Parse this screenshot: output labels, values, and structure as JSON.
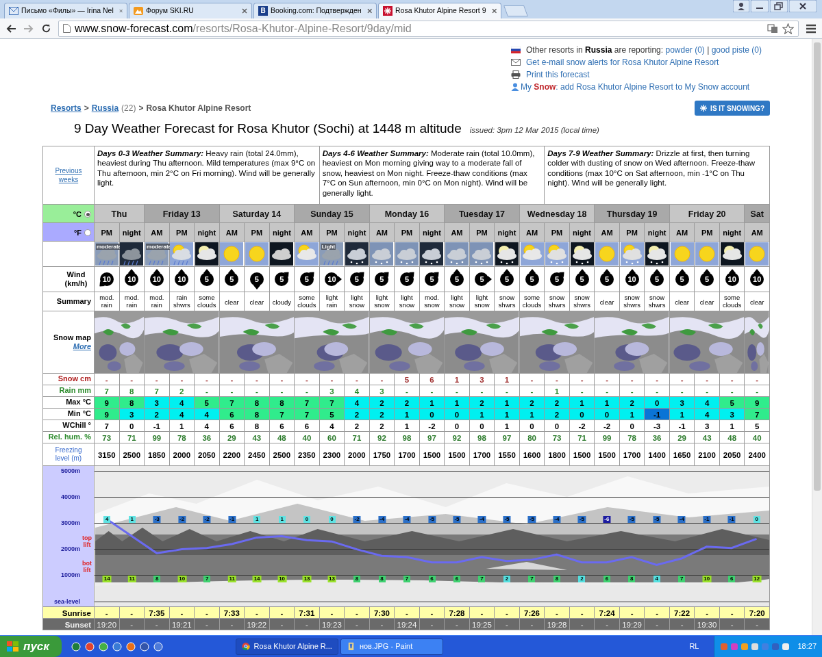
{
  "browser": {
    "tabs": [
      {
        "title": "Письмо «Филы» — Irina Nel",
        "kind": "mail",
        "selected": false
      },
      {
        "title": "Форум SKI.RU",
        "kind": "mountain",
        "selected": false
      },
      {
        "title": "Booking.com: Подтвержден",
        "kind": "letter",
        "favicon_text": "B",
        "selected": false
      },
      {
        "title": "Rosa Khutor Alpine Resort 9",
        "kind": "cross",
        "selected": true
      }
    ],
    "url_host": "www.snow-forecast.com",
    "url_path": "/resorts/Rosa-Khutor-Alpine-Resort/9day/mid"
  },
  "info": {
    "reporting_intro": "Other resorts in **Russia** are reporting:",
    "reporting_links": [
      "powder (0)",
      "good piste (0)"
    ],
    "separator": "|",
    "alerts_link": "Get e-mail snow alerts for Rosa Khutor Alpine Resort",
    "print_link": "Print this forecast",
    "my_snow_link": "My **Snow**: add Rosa Khutor Alpine Resort to My Snow account"
  },
  "breadcrumb": [
    {
      "text": "Resorts",
      "kind": "link"
    },
    {
      "text": ">",
      "kind": "sep"
    },
    {
      "text": "Russia",
      "kind": "link"
    },
    {
      "text": "(22)",
      "kind": "count"
    },
    {
      "text": ">",
      "kind": "sep"
    },
    {
      "text": "Rosa Khutor Alpine Resort",
      "kind": "current"
    }
  ],
  "snowing_button": "IS IT SNOWING?",
  "title": "9 Day Weather Forecast for Rosa Khutor (Sochi) at 1448 m altitude",
  "issued": "issued: 3pm 12 Mar 2015 (local time)",
  "forecast": {
    "previous_link": "Previous weeks",
    "summaries": [
      {
        "title": "Days 0-3 Weather Summary:",
        "text": "Heavy rain (total 24.0mm), heaviest during Thu afternoon. Mild temperatures (max 9°C on Thu afternoon, min 2°C on Fri morning). Wind will be generally light."
      },
      {
        "title": "Days 4-6 Weather Summary:",
        "text": "Moderate rain (total 10.0mm), heaviest on Mon morning giving way to a moderate fall of snow, heaviest on Mon night. Freeze-thaw conditions (max 7°C on Sun afternoon, min 0°C on Mon night). Wind will be generally light."
      },
      {
        "title": "Days 7-9 Weather Summary:",
        "text": "Drizzle at first, then turning colder with dusting of snow on Wed afternoon. Freeze-thaw conditions (max 10°C on Sat afternoon, min -1°C on Thu night). Wind will be generally light."
      }
    ],
    "units": [
      {
        "label": "°C",
        "selected": true
      },
      {
        "label": "°F",
        "selected": false
      }
    ],
    "labels": {
      "wind": "Wind (km/h)",
      "summary": "Summary",
      "snow_map": "Snow map",
      "more": "More",
      "snow": "Snow cm",
      "rain": "Rain mm",
      "max": "Max °C",
      "min": "Min °C",
      "wchill": "WChill °",
      "humidity": "Rel. hum. %",
      "freezing": "Freezing level (m)",
      "top_lift": "top lift",
      "bottom_lift": "bot lift",
      "sunrise": "Sunrise",
      "sunset": "Sunset"
    },
    "days": [
      {
        "label": "Thu",
        "periods": [
          {
            "period": "PM",
            "kind": "cloud-rain",
            "icon_text": "moderate",
            "wind": {
              "speed": "10",
              "kind": "sw"
            },
            "summary": "mod. rain",
            "snow": "-",
            "rain": "7",
            "max": "9",
            "min": "9",
            "wchill": "7",
            "humidity": "73",
            "freezing": "3150",
            "top_lift": "4",
            "bottom_lift": "14",
            "sunrise": "-",
            "sunset": "19:20"
          },
          {
            "period": "night",
            "kind": "night-cloud-rain",
            "wind": {
              "speed": "10",
              "kind": "n"
            },
            "summary": "mod. rain",
            "snow": "-",
            "rain": "8",
            "max": "8",
            "min": "3",
            "wchill": "0",
            "humidity": "71",
            "freezing": "2500",
            "top_lift": "1",
            "bottom_lift": "11",
            "sunrise": "-",
            "sunset": "-"
          }
        ]
      },
      {
        "label": "Friday 13",
        "periods": [
          {
            "period": "AM",
            "kind": "cloud-rain",
            "icon_text": "moderate",
            "wind": {
              "speed": "10",
              "kind": "n"
            },
            "summary": "mod. rain",
            "snow": "-",
            "rain": "7",
            "max": "3",
            "min": "2",
            "wchill": "-1",
            "humidity": "99",
            "freezing": "1850",
            "top_lift": "-3",
            "bottom_lift": "8",
            "sunrise": "7:35",
            "sunset": "-"
          },
          {
            "period": "PM",
            "kind": "sun-cloud-rain",
            "wind": {
              "speed": "10",
              "kind": "n"
            },
            "summary": "rain shwrs",
            "snow": "-",
            "rain": "2",
            "max": "4",
            "min": "4",
            "wchill": "1",
            "humidity": "78",
            "freezing": "2000",
            "top_lift": "-2",
            "bottom_lift": "10",
            "sunrise": "-",
            "sunset": "19:21"
          },
          {
            "period": "night",
            "kind": "moon-cloud",
            "wind": {
              "speed": "5",
              "kind": "n"
            },
            "summary": "some clouds",
            "snow": "-",
            "rain": "-",
            "max": "5",
            "min": "4",
            "wchill": "4",
            "humidity": "36",
            "freezing": "2050",
            "top_lift": "-2",
            "bottom_lift": "7",
            "sunrise": "-",
            "sunset": "-"
          }
        ]
      },
      {
        "label": "Saturday 14",
        "periods": [
          {
            "period": "AM",
            "kind": "sun",
            "wind": {
              "speed": "5",
              "kind": "n"
            },
            "summary": "clear",
            "snow": "-",
            "rain": "-",
            "max": "7",
            "min": "6",
            "wchill": "6",
            "humidity": "29",
            "freezing": "2200",
            "top_lift": "-1",
            "bottom_lift": "11",
            "sunrise": "7:33",
            "sunset": "-"
          },
          {
            "period": "PM",
            "kind": "sun",
            "wind": {
              "speed": "5",
              "kind": "s"
            },
            "summary": "clear",
            "snow": "-",
            "rain": "-",
            "max": "8",
            "min": "8",
            "wchill": "8",
            "humidity": "43",
            "freezing": "2450",
            "top_lift": "1",
            "bottom_lift": "14",
            "sunrise": "-",
            "sunset": "19:22"
          },
          {
            "period": "night",
            "kind": "night-cloud",
            "wind": {
              "speed": "5",
              "kind": "ne"
            },
            "summary": "cloudy",
            "snow": "-",
            "rain": "-",
            "max": "8",
            "min": "7",
            "wchill": "6",
            "humidity": "48",
            "freezing": "2500",
            "top_lift": "1",
            "bottom_lift": "10",
            "sunrise": "-",
            "sunset": "-"
          }
        ]
      },
      {
        "label": "Sunday 15",
        "periods": [
          {
            "period": "AM",
            "kind": "sun-cloud",
            "wind": {
              "speed": "5",
              "kind": "ne"
            },
            "summary": "some clouds",
            "snow": "-",
            "rain": "-",
            "max": "7",
            "min": "7",
            "wchill": "6",
            "humidity": "40",
            "freezing": "2350",
            "top_lift": "0",
            "bottom_lift": "13",
            "sunrise": "7:31",
            "sunset": "-"
          },
          {
            "period": "PM",
            "kind": "cloud-rain",
            "icon_text": "Light",
            "wind": {
              "speed": "10",
              "kind": "e"
            },
            "summary": "light rain",
            "snow": "-",
            "rain": "3",
            "max": "7",
            "min": "5",
            "wchill": "4",
            "humidity": "60",
            "freezing": "2300",
            "top_lift": "0",
            "bottom_lift": "13",
            "sunrise": "-",
            "sunset": "19:23"
          },
          {
            "period": "night",
            "kind": "night-cloud-snow",
            "wind": {
              "speed": "5",
              "kind": "ne"
            },
            "summary": "light snow",
            "snow": "-",
            "rain": "4",
            "max": "4",
            "min": "2",
            "wchill": "2",
            "humidity": "71",
            "freezing": "2000",
            "top_lift": "-2",
            "bottom_lift": "8",
            "sunrise": "-",
            "sunset": "-"
          }
        ]
      },
      {
        "label": "Monday 16",
        "periods": [
          {
            "period": "AM",
            "kind": "cloud-snow",
            "wind": {
              "speed": "5",
              "kind": "ne"
            },
            "summary": "light snow",
            "snow": "-",
            "rain": "3",
            "max": "2",
            "min": "2",
            "wchill": "2",
            "humidity": "92",
            "freezing": "1750",
            "top_lift": "-4",
            "bottom_lift": "8",
            "sunrise": "7:30",
            "sunset": "-"
          },
          {
            "period": "PM",
            "kind": "cloud-snow",
            "wind": {
              "speed": "5",
              "kind": "ne"
            },
            "summary": "light snow",
            "snow": "5",
            "rain": "-",
            "max": "2",
            "min": "1",
            "wchill": "1",
            "humidity": "98",
            "freezing": "1700",
            "top_lift": "-4",
            "bottom_lift": "7",
            "sunrise": "-",
            "sunset": "19:24"
          },
          {
            "period": "night",
            "kind": "night-cloud-snow",
            "wind": {
              "speed": "5",
              "kind": "ne"
            },
            "summary": "mod. snow",
            "snow": "6",
            "rain": "-",
            "max": "1",
            "min": "0",
            "wchill": "-2",
            "humidity": "97",
            "freezing": "1500",
            "top_lift": "-5",
            "bottom_lift": "6",
            "sunrise": "-",
            "sunset": "-"
          }
        ]
      },
      {
        "label": "Tuesday 17",
        "periods": [
          {
            "period": "AM",
            "kind": "cloud-snow",
            "wind": {
              "speed": "5",
              "kind": "n"
            },
            "summary": "light snow",
            "snow": "1",
            "rain": "-",
            "max": "1",
            "min": "0",
            "wchill": "0",
            "humidity": "92",
            "freezing": "1500",
            "top_lift": "-5",
            "bottom_lift": "6",
            "sunrise": "7:28",
            "sunset": "-"
          },
          {
            "period": "PM",
            "kind": "cloud-snow",
            "wind": {
              "speed": "5",
              "kind": "e"
            },
            "summary": "light snow",
            "snow": "3",
            "rain": "-",
            "max": "2",
            "min": "1",
            "wchill": "0",
            "humidity": "98",
            "freezing": "1700",
            "top_lift": "-4",
            "bottom_lift": "7",
            "sunrise": "-",
            "sunset": "19:25"
          },
          {
            "period": "night",
            "kind": "moon-cloud-snow",
            "wind": {
              "speed": "5",
              "kind": "n"
            },
            "summary": "snow shwrs",
            "snow": "1",
            "rain": "-",
            "max": "1",
            "min": "1",
            "wchill": "1",
            "humidity": "97",
            "freezing": "1550",
            "top_lift": "-5",
            "bottom_lift": "2",
            "sunrise": "-",
            "sunset": "-"
          }
        ]
      },
      {
        "label": "Wednesday 18",
        "periods": [
          {
            "period": "AM",
            "kind": "sun-cloud",
            "wind": {
              "speed": "5",
              "kind": "n"
            },
            "summary": "some clouds",
            "snow": "-",
            "rain": "-",
            "max": "2",
            "min": "1",
            "wchill": "0",
            "humidity": "80",
            "freezing": "1600",
            "top_lift": "-5",
            "bottom_lift": "7",
            "sunrise": "7:26",
            "sunset": "-"
          },
          {
            "period": "PM",
            "kind": "sun-cloud-snow",
            "wind": {
              "speed": "5",
              "kind": "ne"
            },
            "summary": "snow shwrs",
            "snow": "-",
            "rain": "1",
            "max": "2",
            "min": "2",
            "wchill": "0",
            "humidity": "73",
            "freezing": "1800",
            "top_lift": "-4",
            "bottom_lift": "8",
            "sunrise": "-",
            "sunset": "19:28"
          },
          {
            "period": "night",
            "kind": "moon-cloud-snow",
            "wind": {
              "speed": "5",
              "kind": "n"
            },
            "summary": "snow shwrs",
            "snow": "-",
            "rain": "-",
            "max": "1",
            "min": "0",
            "wchill": "-2",
            "humidity": "71",
            "freezing": "1500",
            "top_lift": "-5",
            "bottom_lift": "2",
            "sunrise": "-",
            "sunset": "-"
          }
        ]
      },
      {
        "label": "Thursday 19",
        "periods": [
          {
            "period": "AM",
            "kind": "sun",
            "wind": {
              "speed": "5",
              "kind": "n"
            },
            "summary": "clear",
            "snow": "-",
            "rain": "-",
            "max": "1",
            "min": "0",
            "wchill": "-2",
            "humidity": "99",
            "freezing": "1500",
            "top_lift": "-6",
            "bottom_lift": "6",
            "sunrise": "7:24",
            "sunset": "-"
          },
          {
            "period": "PM",
            "kind": "sun-cloud-snow",
            "wind": {
              "speed": "10",
              "kind": "n"
            },
            "summary": "snow shwrs",
            "snow": "-",
            "rain": "-",
            "max": "2",
            "min": "1",
            "wchill": "0",
            "humidity": "78",
            "freezing": "1700",
            "top_lift": "-5",
            "bottom_lift": "8",
            "sunrise": "-",
            "sunset": "19:29"
          },
          {
            "period": "night",
            "kind": "moon-cloud-snow",
            "wind": {
              "speed": "5",
              "kind": "n"
            },
            "summary": "snow shwrs",
            "snow": "-",
            "rain": "-",
            "max": "0",
            "min": "-1",
            "wchill": "-3",
            "humidity": "36",
            "freezing": "1400",
            "top_lift": "-5",
            "bottom_lift": "4",
            "sunrise": "-",
            "sunset": "-"
          }
        ]
      },
      {
        "label": "Friday 20",
        "periods": [
          {
            "period": "AM",
            "kind": "sun",
            "wind": {
              "speed": "5",
              "kind": "n"
            },
            "summary": "clear",
            "snow": "-",
            "rain": "-",
            "max": "3",
            "min": "1",
            "wchill": "-1",
            "humidity": "29",
            "freezing": "1650",
            "top_lift": "-4",
            "bottom_lift": "7",
            "sunrise": "7:22",
            "sunset": "-"
          },
          {
            "period": "PM",
            "kind": "sun",
            "wind": {
              "speed": "5",
              "kind": "n"
            },
            "summary": "clear",
            "snow": "-",
            "rain": "-",
            "max": "4",
            "min": "4",
            "wchill": "3",
            "humidity": "43",
            "freezing": "2100",
            "top_lift": "-1",
            "bottom_lift": "10",
            "sunrise": "-",
            "sunset": "19:30"
          },
          {
            "period": "night",
            "kind": "moon-cloud",
            "wind": {
              "speed": "10",
              "kind": "n"
            },
            "summary": "some clouds",
            "snow": "-",
            "rain": "-",
            "max": "5",
            "min": "3",
            "wchill": "1",
            "humidity": "48",
            "freezing": "2050",
            "top_lift": "-1",
            "bottom_lift": "6",
            "sunrise": "-",
            "sunset": "-"
          }
        ]
      },
      {
        "label": "Sat",
        "periods": [
          {
            "period": "AM",
            "kind": "sun",
            "wind": {
              "speed": "10",
              "kind": "n"
            },
            "summary": "clear",
            "snow": "-",
            "rain": "-",
            "max": "9",
            "min": "7",
            "wchill": "5",
            "humidity": "40",
            "freezing": "2400",
            "top_lift": "0",
            "bottom_lift": "12",
            "sunrise": "7:20",
            "sunset": "-"
          }
        ]
      }
    ],
    "freezing_chart": {
      "chart_data": {
        "type": "line",
        "grid": true,
        "ylim": [
          0,
          5000
        ],
        "yticks": [
          {
            "value": 0,
            "label": "sea-level"
          },
          {
            "value": 1000,
            "label": "1000m"
          },
          {
            "value": 2000,
            "label": "2000m"
          },
          {
            "value": 3000,
            "label": "3000m"
          },
          {
            "value": 4000,
            "label": "4000m"
          },
          {
            "value": 5000,
            "label": "5000m"
          }
        ],
        "series": [
          {
            "color": "#6a6af0",
            "values": [
              3150,
              2500,
              1850,
              2000,
              2050,
              2200,
              2450,
              2500,
              2350,
              2300,
              2000,
              1750,
              1700,
              1500,
              1500,
              1700,
              1550,
              1600,
              1800,
              1500,
              1500,
              1700,
              1400,
              1650,
              2100,
              2050,
              2400
            ]
          }
        ]
      }
    }
  },
  "taskbar": {
    "start": "пуск",
    "tasks": [
      {
        "title": "Rosa Khutor Alpine R...",
        "kind": "browser",
        "selected": false
      },
      {
        "title": "нов.JPG - Paint",
        "kind": "paint",
        "selected": true
      }
    ],
    "language": "RL",
    "clock": "18:27"
  }
}
